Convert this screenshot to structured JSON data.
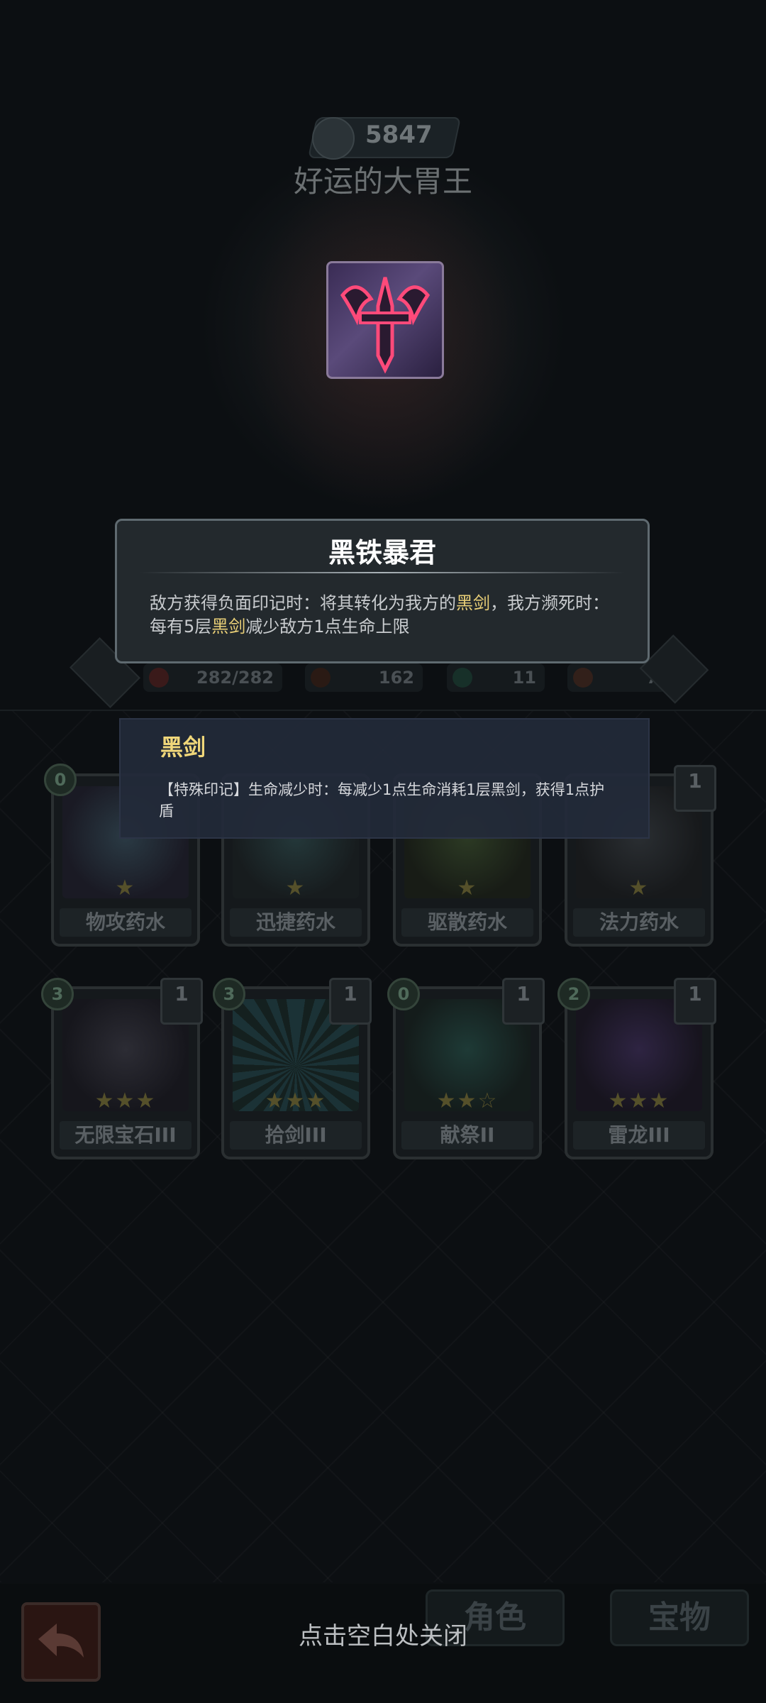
{
  "header": {
    "score": "5847",
    "hero_name": "好运的大胃王"
  },
  "stats": {
    "hp": "282/282",
    "attack": "162",
    "shield": "11",
    "energy": "7"
  },
  "popup_main": {
    "title": "黑铁暴君",
    "desc_part1": "敌方获得负面印记时：将其转化为我方的",
    "desc_hl1": "黑剑",
    "desc_part2": "，我方濒死时：每有5层",
    "desc_hl2": "黑剑",
    "desc_part3": "减少敌方1点生命上限"
  },
  "popup_sub": {
    "title": "黑剑",
    "desc": "【特殊印记】生命减少时：每减少1点生命消耗1层黑剑，获得1点护盾"
  },
  "cards_row1": [
    {
      "name": "物攻药水",
      "cost": "0",
      "count": "",
      "stars": "★"
    },
    {
      "name": "迅捷药水",
      "cost": "",
      "count": "",
      "stars": "★"
    },
    {
      "name": "驱散药水",
      "cost": "",
      "count": "",
      "stars": "★"
    },
    {
      "name": "法力药水",
      "cost": "",
      "count": "1",
      "stars": "★"
    }
  ],
  "cards_row2": [
    {
      "name": "无限宝石III",
      "cost": "3",
      "count": "1",
      "stars": "★★★"
    },
    {
      "name": "拾剑III",
      "cost": "3",
      "count": "1",
      "stars": "★★★"
    },
    {
      "name": "献祭II",
      "cost": "0",
      "count": "1",
      "stars": "★★☆"
    },
    {
      "name": "雷龙III",
      "cost": "2",
      "count": "1",
      "stars": "★★★"
    }
  ],
  "bottom": {
    "tab_role": "角色",
    "tab_treasure": "宝物",
    "close_hint": "点击空白处关闭"
  }
}
